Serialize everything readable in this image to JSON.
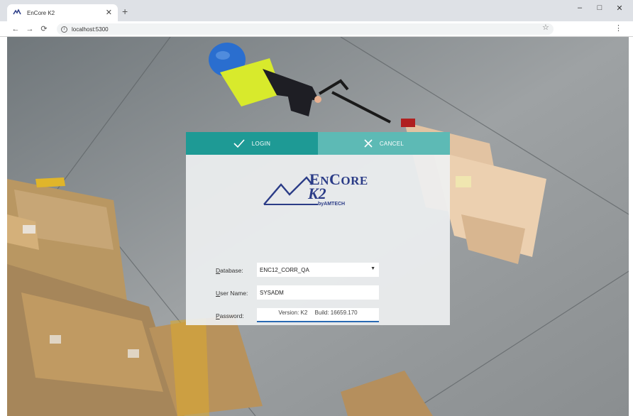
{
  "browser": {
    "tab_title": "EnCore K2",
    "url": "localhost:5300",
    "controls": {
      "minimize": "–",
      "maximize": "□",
      "close": "✕"
    }
  },
  "login": {
    "login_label": "LOGIN",
    "cancel_label": "CANCEL",
    "logo": {
      "title_initial": "E",
      "title_rest": "N",
      "title_c": "C",
      "title_rest2": "ORE",
      "k2": "K2",
      "by": "byAMTECH"
    },
    "database_label": "Database:",
    "database_access_key": "D",
    "database_rest": "atabase:",
    "database_value": "ENC12_CORR_QA",
    "username_access_key": "U",
    "username_rest": "ser Name:",
    "username_value": "SYSADM",
    "password_access_key": "P",
    "password_rest": "assword:",
    "password_value": "",
    "version": "Version: K2",
    "build": "Build: 16659.170"
  },
  "colors": {
    "login_button": "#1e9a95",
    "cancel_button": "#5dbab5",
    "logo": "#2b3c87"
  }
}
